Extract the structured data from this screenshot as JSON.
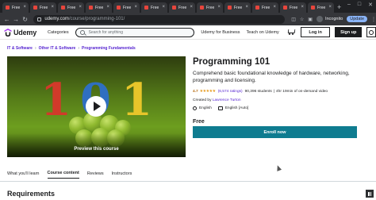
{
  "browser": {
    "tabs": [
      {
        "title": "Free"
      },
      {
        "title": "Free"
      },
      {
        "title": "Free"
      },
      {
        "title": "Free"
      },
      {
        "title": "Free"
      },
      {
        "title": "Free"
      },
      {
        "title": "Free"
      },
      {
        "title": "Free"
      },
      {
        "title": "Free"
      },
      {
        "title": "Free"
      },
      {
        "title": "Free"
      },
      {
        "title": "Free"
      }
    ],
    "url_host": "udemy.com",
    "url_path": "/course/programming-101/",
    "profile_label": "Incognito",
    "update_label": "Update"
  },
  "header": {
    "logo_text": "Udemy",
    "categories_label": "Categories",
    "search_placeholder": "Search for anything",
    "business_link": "Udemy for Business",
    "teach_link": "Teach on Udemy",
    "login_label": "Log in",
    "signup_label": "Sign up"
  },
  "breadcrumb": [
    "IT & Software",
    "Other IT & Software",
    "Programming Fundamentals"
  ],
  "video": {
    "label": "Preview this course",
    "digits": [
      {
        "text": "1",
        "color": "#d13a2a"
      },
      {
        "text": "0",
        "color": "#2f6fc0"
      },
      {
        "text": "1",
        "color": "#e7c52a"
      }
    ]
  },
  "course": {
    "title": "Programming 101",
    "subtitle": "Comprehend basic foundational knowledge of hardware, networking, programming and licensing.",
    "rating": "4.7",
    "stars": "★★★★★",
    "ratings_count": "(6,574 ratings)",
    "students": "90,396 students",
    "duration": "4hr 19min of on-demand video",
    "created_prefix": "Created by",
    "instructor": "Lawrence Turton",
    "language": "English",
    "captions": "English [Auto]",
    "price": "Free",
    "enroll_label": "Enroll now"
  },
  "content_tabs": [
    "What you'll learn",
    "Course content",
    "Reviews",
    "Instructors"
  ],
  "active_tab": "Course content",
  "section_heading": "Requirements",
  "colors": {
    "accent": "#5624d0",
    "enroll": "#0f7c90",
    "star": "#e59819"
  }
}
